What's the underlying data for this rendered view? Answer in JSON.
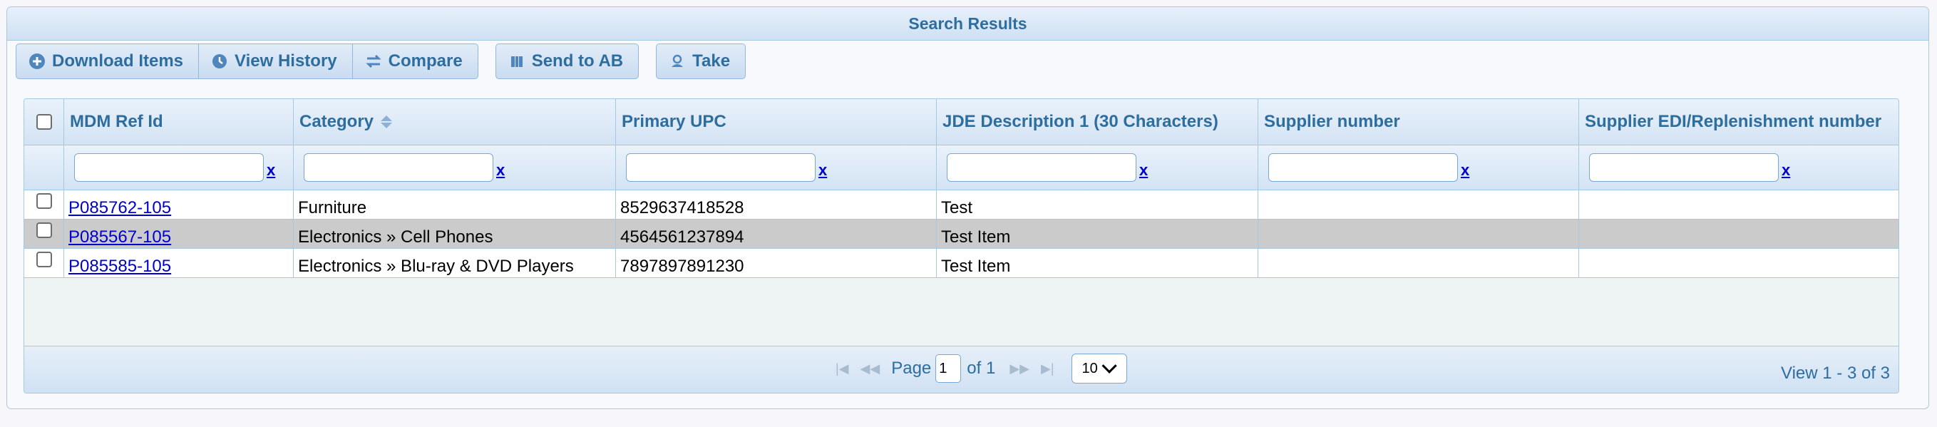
{
  "panel": {
    "title": "Search Results"
  },
  "toolbar": {
    "download": "Download Items",
    "history": "View History",
    "compare": "Compare",
    "send": "Send to AB",
    "take": "Take"
  },
  "grid": {
    "columns": [
      "MDM Ref Id",
      "Category",
      "Primary UPC",
      "JDE Description 1 (30 Characters)",
      "Supplier number",
      "Supplier EDI/Replenishment number"
    ],
    "clear_label": "x",
    "rows": [
      {
        "ref": "P085762-105",
        "category": "Furniture",
        "upc": "8529637418528",
        "desc": "Test",
        "supplier": "",
        "edi": "",
        "selected": false
      },
      {
        "ref": "P085567-105",
        "category": "Electronics » Cell Phones",
        "upc": "4564561237894",
        "desc": "Test Item",
        "supplier": "",
        "edi": "",
        "selected": true
      },
      {
        "ref": "P085585-105",
        "category": "Electronics » Blu-ray & DVD Players",
        "upc": "7897897891230",
        "desc": "Test Item",
        "supplier": "",
        "edi": "",
        "selected": false
      }
    ]
  },
  "pager": {
    "page_label": "Page",
    "page_value": "1",
    "of_label": "of 1",
    "rows_per_page": "10",
    "view_label": "View 1 - 3 of 3"
  },
  "colors": {
    "header_text": "#2e6e9e",
    "border": "#a6c9e2",
    "link": "#0000cc",
    "selected_row": "#cbcbcb"
  }
}
